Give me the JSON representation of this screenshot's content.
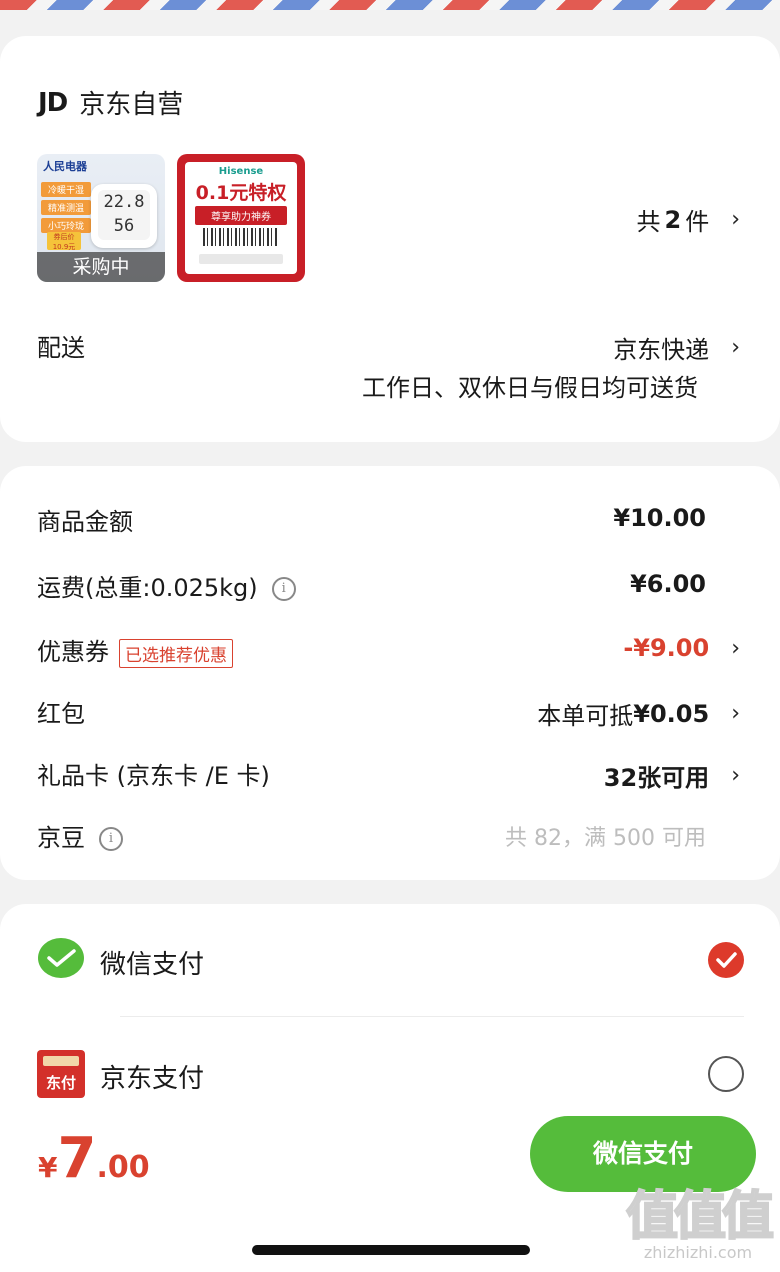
{
  "shop": {
    "logo": "JD",
    "name": "京东自营"
  },
  "products": {
    "item1": {
      "brand": "人民电器",
      "tags": [
        "冷暖干湿",
        "精准测温",
        "小巧玲珑"
      ],
      "price_tag": "券后价 10.9元",
      "temp": "22.8",
      "humidity": "56",
      "status": "采购中"
    },
    "item2": {
      "brand": "Hisense",
      "headline": "0.1元特权",
      "subline": "尊享助力神券"
    },
    "count_prefix": "共",
    "count_num": "2",
    "count_suffix": "件"
  },
  "delivery": {
    "label": "配送",
    "method": "京东快递",
    "schedule": "工作日、双休日与假日均可送货"
  },
  "summary": {
    "goods_label": "商品金额",
    "goods_value": "¥10.00",
    "freight_label": "运费(总重:0.025kg)",
    "freight_value": "¥6.00",
    "coupon_label": "优惠券",
    "coupon_badge": "已选推荐优惠",
    "coupon_value": "-¥9.00",
    "redpacket_label": "红包",
    "redpacket_prefix": "本单可抵",
    "redpacket_value": "¥0.05",
    "giftcard_label": "礼品卡 (京东卡 /E 卡)",
    "giftcard_value": "32张可用",
    "jingdou_label": "京豆",
    "jingdou_value": "共 82，满 500 可用"
  },
  "payment": {
    "wechat_label": "微信支付",
    "wechat_selected": true,
    "jdpay_label": "京东支付",
    "jdpay_icon_text": "东付",
    "jdpay_selected": false
  },
  "footer": {
    "currency": "¥",
    "total_int": "7",
    "total_dec": ".00",
    "submit_label": "微信支付"
  },
  "watermark": {
    "glyph": "值值值",
    "url": "zhizhizhi.com"
  },
  "colors": {
    "accent_red": "#d9422f",
    "wechat_green": "#55bc3b"
  }
}
